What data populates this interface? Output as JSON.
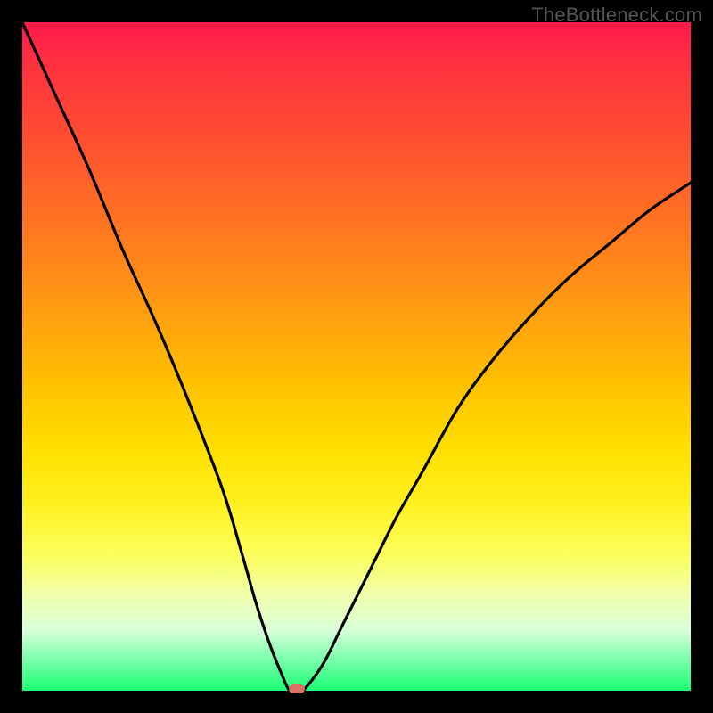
{
  "watermark": "TheBottleneck.com",
  "chart_data": {
    "type": "line",
    "title": "",
    "xlabel": "",
    "ylabel": "",
    "xlim": [
      0,
      100
    ],
    "ylim": [
      0,
      100
    ],
    "grid": false,
    "legend": false,
    "series": [
      {
        "name": "bottleneck-curve",
        "x": [
          0,
          5,
          10,
          15,
          20,
          25,
          30,
          33,
          35,
          37,
          39,
          40,
          41,
          42,
          45,
          48,
          52,
          56,
          60,
          65,
          70,
          76,
          82,
          88,
          94,
          100
        ],
        "values": [
          100,
          89,
          78,
          66,
          55,
          43,
          30,
          20,
          13,
          7,
          2,
          0,
          0,
          0,
          4,
          10,
          18,
          26,
          33,
          42,
          49,
          56,
          62,
          67,
          72,
          76
        ]
      }
    ],
    "marker": {
      "x": 41,
      "y": 0,
      "color": "#d87264"
    },
    "background_gradient": {
      "top": "#ff1a4a",
      "mid": "#ffe000",
      "bottom": "#1bff73"
    },
    "frame_color": "#000000"
  }
}
